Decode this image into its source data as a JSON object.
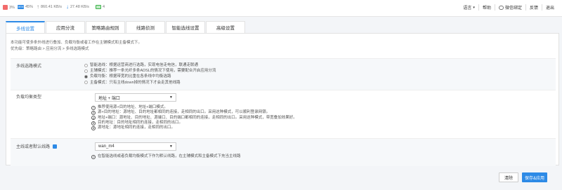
{
  "topbar": {
    "cpu": "3%",
    "mem_icon_text": "MEM",
    "mem": "45%",
    "upload": "860.41 KB/s",
    "download": "27.48 KB/s",
    "online": "4",
    "menu": {
      "language": "语言",
      "help": "帮助",
      "wechat": "微信绑定",
      "feedback": "反馈",
      "logout": "退出"
    }
  },
  "tabs": [
    "多线设置",
    "应用分流",
    "策略路由规则",
    "线路侦测",
    "智能选线设置",
    "高级设置"
  ],
  "intro": {
    "line1": "本功能可使多条外线进行叠加、负载均衡或者工作在主辅模式和主备模式下。",
    "line2": "优先级：策略路由 > 应用分流 > 多线选路模式"
  },
  "mode": {
    "label": "多线选路模式",
    "options": [
      "智能选线：根据运营商进行选路，实现电信走电信，联通走联通",
      "主辅模式：推荐一条光纤多条ADSL的情况下使用，需要配合开启应用分流",
      "负载均衡：根据带宽的比重在各条线中均衡选路",
      "主备模式：只有主线down掉的情况下才会走其他线路"
    ],
    "selected_index": 2
  },
  "lb": {
    "label": "负载均衡类型",
    "selected": "地址 + 端口",
    "hints": [
      "推荐使用源+目的地址、地址+端口模式。",
      "源+目的地址：源地址、目的地址都相同的连接，走相同的出口。采用这种模式，可以顺利登录网银。",
      "地址+端口：源地址、目的地址、源端口、目的端口都相同的连接，走相同的出口。采用这种模式，带宽叠加效果好。",
      "目的地址：目的地址相同的连接，走相同的出口。",
      "源地址：源地址相同的连接，走相同的出口。"
    ]
  },
  "default_line": {
    "label": "主线或者默认线路",
    "selected": "wan_m4",
    "hint": "在智能选线或者负载均衡模式下作为默认线路，在主辅模式和主备模式下充当主线路"
  },
  "buttons": {
    "clear": "清除",
    "save": "保存&应用"
  }
}
